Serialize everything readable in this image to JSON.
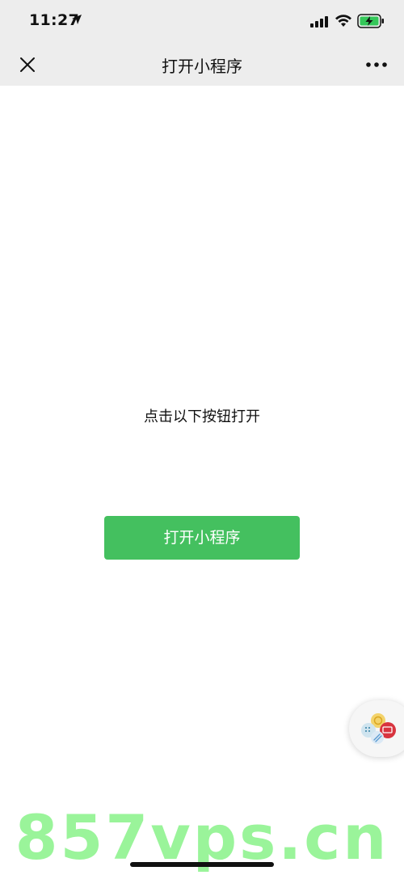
{
  "status_bar": {
    "time": "11:27",
    "icons": [
      "location-arrow-icon",
      "cellular-signal-icon",
      "wifi-icon",
      "battery-charging-icon"
    ]
  },
  "nav_bar": {
    "title": "打开小程序",
    "close_icon": "close-icon",
    "more_icon": "more-dots-icon"
  },
  "content": {
    "prompt": "点击以下按钮打开",
    "open_button_label": "打开小程序"
  },
  "floating_widget": {
    "icon": "mini-program-bubble-icon"
  },
  "watermark": {
    "text": "857vps.cn"
  },
  "colors": {
    "nav_background": "#ededed",
    "accent_green": "#44c05f",
    "watermark_green": "#78f078",
    "text_primary": "#111111"
  }
}
